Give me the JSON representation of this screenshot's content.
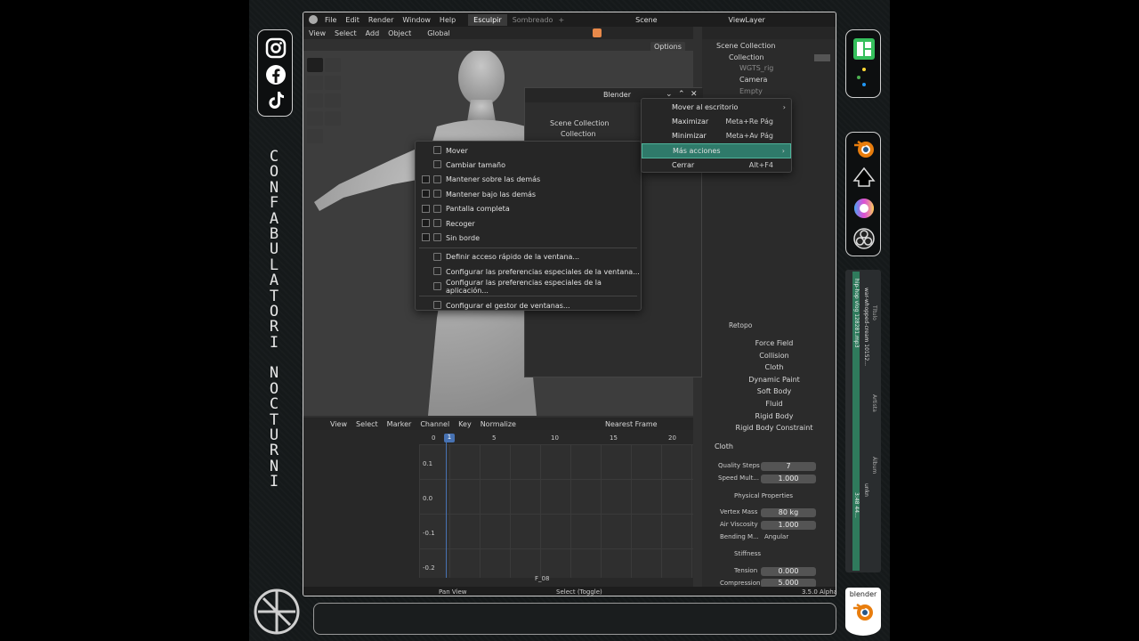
{
  "social": {
    "icons": [
      "instagram-icon",
      "facebook-icon",
      "tiktok-icon"
    ]
  },
  "vertical_text": [
    "C",
    "O",
    "N",
    "F",
    "A",
    "B",
    "U",
    "L",
    "A",
    "T",
    "O",
    "R",
    "I",
    "",
    "N",
    "O",
    "C",
    "T",
    "U",
    "R",
    "N",
    "I"
  ],
  "apps": {
    "icons": [
      "manjaro-icon",
      "kde-dots-icon",
      "blender-icon",
      "inkscape-icon",
      "krita-icon",
      "obs-icon"
    ]
  },
  "blender_badge": "blender",
  "topbar": {
    "menus": [
      "File",
      "Edit",
      "Render",
      "Window",
      "Help"
    ],
    "workspaces": [
      "Esculpir",
      "Sombreado"
    ],
    "plus": "+",
    "scene": "Scene",
    "viewlayer": "ViewLayer"
  },
  "viewport_header": {
    "menus": [
      "View",
      "Select",
      "Add",
      "Object"
    ],
    "orientation": "Global",
    "options": "Options"
  },
  "outliner": {
    "items": [
      {
        "label": "Scene Collection"
      },
      {
        "label": "Collection"
      },
      {
        "label": "WGTS_rig"
      },
      {
        "label": "Camera"
      },
      {
        "label": "Empty"
      }
    ]
  },
  "float_window": {
    "title": "Blender",
    "items": [
      "Scene Collection",
      "Collection"
    ]
  },
  "context_menu": {
    "items": [
      {
        "label": "Mover",
        "icon": "move-icon"
      },
      {
        "label": "Cambiar tamaño",
        "icon": "resize-icon"
      },
      {
        "label": "Mantener sobre las demás",
        "icon": "keep-above-icon",
        "check": true
      },
      {
        "label": "Mantener bajo las demás",
        "icon": "keep-below-icon",
        "check": true
      },
      {
        "label": "Pantalla completa",
        "icon": "fullscreen-icon",
        "check": true
      },
      {
        "label": "Recoger",
        "icon": "shade-icon",
        "check": true
      },
      {
        "label": "Sin borde",
        "icon": "no-border-icon",
        "check": true
      },
      {
        "label": "Definir acceso rápido de la ventana...",
        "icon": "keyboard-icon",
        "sep": true
      },
      {
        "label": "Configurar las preferencias especiales de la ventana...",
        "icon": "window-settings-icon"
      },
      {
        "label": "Configurar las preferencias especiales de la aplicación...",
        "icon": "app-settings-icon"
      },
      {
        "label": "Configurar el gestor de ventanas...",
        "icon": "wm-settings-icon",
        "sep": true
      }
    ]
  },
  "window_menu": {
    "items": [
      {
        "label": "Mover al escritorio",
        "shortcut": "",
        "arrow": true
      },
      {
        "label": "Maximizar",
        "shortcut": "Meta+Re Pág"
      },
      {
        "label": "Minimizar",
        "shortcut": "Meta+Av Pág"
      },
      {
        "label": "Más acciones",
        "shortcut": "",
        "arrow": true
      },
      {
        "label": "Cerrar",
        "shortcut": "Alt+F4"
      }
    ]
  },
  "graph_editor": {
    "menus": [
      "View",
      "Select",
      "Marker",
      "Channel",
      "Key"
    ],
    "normalize": "Normalize",
    "frame_mode": "Nearest Frame",
    "current_frame": "1",
    "frame_ticks": [
      "0",
      "5",
      "10",
      "15",
      "20"
    ],
    "y_ticks": [
      "0.1",
      "0.0",
      "-0.1",
      "-0.2"
    ],
    "marker": "F_08"
  },
  "status": {
    "left": "Pan View",
    "mid": "Select (Toggle)",
    "version": "3.5.0 Alpha"
  },
  "properties": {
    "object": "Retopo",
    "physics_buttons": [
      "Force Field",
      "Collision",
      "Cloth",
      "Dynamic Paint",
      "Soft Body",
      "Fluid",
      "Rigid Body",
      "Rigid Body Constraint"
    ],
    "cloth_title": "Cloth",
    "fields": [
      {
        "label": "Quality Steps",
        "value": "7"
      },
      {
        "label": "Speed Mult...",
        "value": "1.000"
      }
    ],
    "physical_title": "Physical Properties",
    "physical": [
      {
        "label": "Vertex Mass",
        "value": "80 kg"
      },
      {
        "label": "Air Viscosity",
        "value": "1.000"
      },
      {
        "label": "Bending M...",
        "value": "Angular"
      }
    ],
    "stiffness_title": "Stiffness",
    "stiffness": [
      {
        "label": "Tension",
        "value": "0.000"
      },
      {
        "label": "Compression",
        "value": "5.000"
      }
    ]
  },
  "media": {
    "col1": "Título",
    "col2": "Artista",
    "col3": "Álbum",
    "track": "hip-hop vlog 128281.mp3",
    "track2": "war-whopped-cream 10152...",
    "album": "unkn",
    "year": "3:48  44..."
  },
  "colors": {
    "accent": "#4772b3",
    "orange": "#e8894a",
    "green": "#2f7a5c",
    "highlight": "#3a8f7a"
  }
}
